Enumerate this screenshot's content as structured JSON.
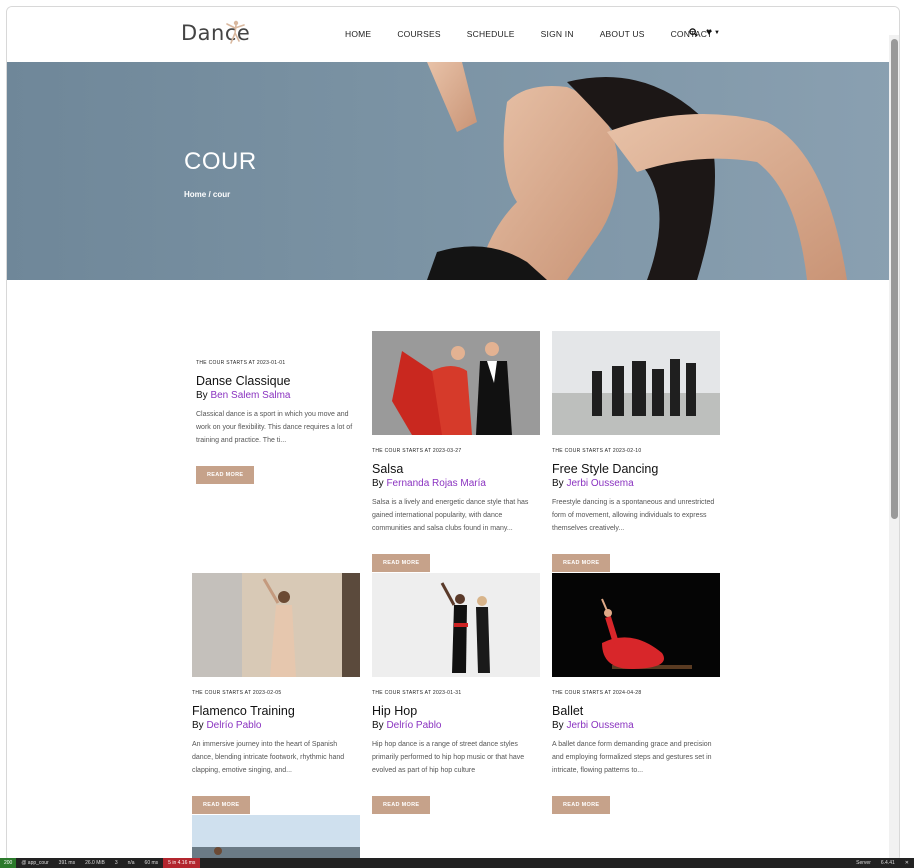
{
  "brand": {
    "name": "Dance"
  },
  "nav": {
    "items": [
      "HOME",
      "COURSES",
      "SCHEDULE",
      "SIGN IN",
      "ABOUT US",
      "CONTACT"
    ],
    "icons": [
      "search-icon",
      "heart-icon",
      "caret-down-icon"
    ]
  },
  "hero": {
    "title": "COUR",
    "breadcrumb": "Home / cour"
  },
  "courses": [
    {
      "date": "THE COUR STARTS AT 2023-01-01",
      "title": "Danse Classique",
      "by": "By",
      "author": "Ben Salem Salma",
      "desc": "Classical dance is a sport in which you move and work on your flexibility. This dance requires a lot of training and practice. The ti...",
      "button": "READ MORE",
      "image": "none"
    },
    {
      "date": "THE COUR STARTS AT 2023-03-27",
      "title": "Salsa",
      "by": "By",
      "author": "Fernanda Rojas María",
      "desc": "Salsa is a lively and energetic dance style that has gained international popularity, with dance communities and salsa clubs found in many...",
      "button": "READ MORE",
      "image": "salsa-couple"
    },
    {
      "date": "THE COUR STARTS AT 2023-02-10",
      "title": "Free Style Dancing",
      "by": "By",
      "author": "Jerbi Oussema",
      "desc": "Freestyle dancing is a spontaneous and unrestricted form of movement, allowing individuals to express themselves creatively...",
      "button": "READ MORE",
      "image": "freestyle-group"
    },
    {
      "date": "THE COUR STARTS AT 2023-02-05",
      "title": "Flamenco Training",
      "by": "By",
      "author": "Delrío Pablo",
      "desc": "An immersive journey into the heart of Spanish dance, blending intricate footwork, rhythmic hand clapping, emotive singing, and...",
      "button": "READ MORE",
      "image": "flamenco-dancer"
    },
    {
      "date": "THE COUR STARTS AT 2023-01-31",
      "title": "Hip Hop",
      "by": "By",
      "author": "Delrío Pablo",
      "desc": "Hip hop dance is a range of street dance styles primarily performed to hip hop music or that have evolved as part of hip hop culture",
      "button": "READ MORE",
      "image": "hiphop-duo"
    },
    {
      "date": "THE COUR STARTS AT 2024-04-28",
      "title": "Ballet",
      "by": "By",
      "author": "Jerbi Oussema",
      "desc": "A ballet dance form demanding grace and precision and employing formalized steps and gestures set in intricate, flowing patterns to...",
      "button": "READ MORE",
      "image": "ballet-red-dress"
    }
  ],
  "debug": {
    "status": "200",
    "route": "@ app_cour",
    "time": "391 ms",
    "memory": "26.0 MiB",
    "count": "3",
    "user": "n/a",
    "db": "60 ms",
    "errors": "5 in 4.16 ms",
    "server": "Server",
    "version": "6.4.41"
  }
}
